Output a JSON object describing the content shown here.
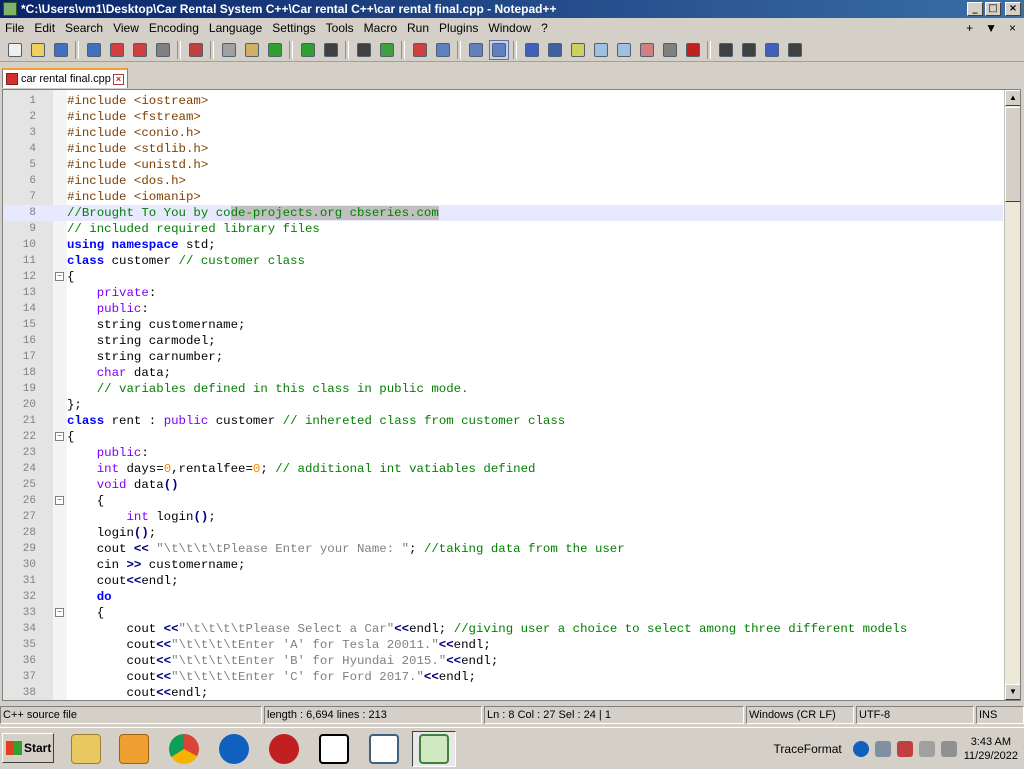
{
  "window": {
    "title": "*C:\\Users\\vm1\\Desktop\\Car Rental System C++\\Car rental C++\\car rental final.cpp - Notepad++",
    "min": "_",
    "max": "□",
    "close": "×"
  },
  "menu": {
    "items": [
      "File",
      "Edit",
      "Search",
      "View",
      "Encoding",
      "Language",
      "Settings",
      "Tools",
      "Macro",
      "Run",
      "Plugins",
      "Window",
      "?"
    ],
    "right": [
      "+",
      "▼",
      "×"
    ]
  },
  "toolbar": {
    "icons": [
      "new-icon",
      "open-icon",
      "save-icon",
      "save-all-icon",
      "close-icon",
      "close-all-icon",
      "print-icon",
      "cut-icon",
      "copy-icon",
      "paste-icon",
      "undo-icon",
      "redo-icon",
      "find-icon",
      "replace-icon",
      "zoom-in-icon",
      "zoom-out-icon",
      "sync-v-icon",
      "sync-h-icon",
      "wrap-icon",
      "all-chars-icon",
      "indent-guide-icon",
      "udl-icon",
      "doc-map-icon",
      "func-list-icon",
      "folder-workspace-icon",
      "monitor-icon",
      "record-macro-icon",
      "stop-macro-icon",
      "play-macro-icon",
      "run-macro-multiple-icon",
      "save-macro-icon"
    ]
  },
  "tab": {
    "label": "car rental final.cpp",
    "close": "×"
  },
  "editor": {
    "lines": [
      {
        "n": "1",
        "html": "<span class='s-pre'>#include &lt;iostream&gt;</span>"
      },
      {
        "n": "2",
        "html": "<span class='s-pre'>#include &lt;fstream&gt;</span>"
      },
      {
        "n": "3",
        "html": "<span class='s-pre'>#include &lt;conio.h&gt;</span>"
      },
      {
        "n": "4",
        "html": "<span class='s-pre'>#include &lt;stdlib.h&gt;</span>"
      },
      {
        "n": "5",
        "html": "<span class='s-pre'>#include &lt;unistd.h&gt;</span>"
      },
      {
        "n": "6",
        "html": "<span class='s-pre'>#include &lt;dos.h&gt;</span>"
      },
      {
        "n": "7",
        "html": "<span class='s-pre'>#include &lt;iomanip&gt;</span>"
      },
      {
        "n": "8",
        "html": "<span class='s-com'>//Brought To You by co<span class='s-sel'>de-projects.org cbseries.com</span></span>",
        "current": true
      },
      {
        "n": "9",
        "html": "<span class='s-com'>// included required library files</span>"
      },
      {
        "n": "10",
        "html": "<span class='s-kw'>using namespace</span> std;"
      },
      {
        "n": "11",
        "html": "<span class='s-kw'>class</span> customer <span class='s-com'>// customer class</span>"
      },
      {
        "n": "12",
        "html": "{",
        "fold": "−"
      },
      {
        "n": "13",
        "html": "    <span class='s-ty'>private</span>:"
      },
      {
        "n": "14",
        "html": "    <span class='s-ty'>public</span>:"
      },
      {
        "n": "15",
        "html": "    string customername;"
      },
      {
        "n": "16",
        "html": "    string carmodel;"
      },
      {
        "n": "17",
        "html": "    string carnumber;"
      },
      {
        "n": "18",
        "html": "    <span class='s-ty'>char</span> data;"
      },
      {
        "n": "19",
        "html": "    <span class='s-com'>// variables defined in this class in public mode.</span>"
      },
      {
        "n": "20",
        "html": "};"
      },
      {
        "n": "21",
        "html": "<span class='s-kw'>class</span> rent : <span class='s-ty'>public</span> customer <span class='s-com'>// inhereted class from customer class</span>"
      },
      {
        "n": "22",
        "html": "{",
        "fold": "−"
      },
      {
        "n": "23",
        "html": "    <span class='s-ty'>public</span>:"
      },
      {
        "n": "24",
        "html": "    <span class='s-ty'>int</span> days=<span class='s-num'>0</span>,rentalfee=<span class='s-num'>0</span>; <span class='s-com'>// additional int vatiables defined</span>"
      },
      {
        "n": "25",
        "html": "    <span class='s-ty'>void</span> data<span class='s-op'>()</span>"
      },
      {
        "n": "26",
        "html": "    {",
        "fold": "−"
      },
      {
        "n": "27",
        "html": "        <span class='s-ty'>int</span> login<span class='s-op'>()</span>;"
      },
      {
        "n": "28",
        "html": "    login<span class='s-op'>()</span>;"
      },
      {
        "n": "29",
        "html": "    cout <span class='s-op'>&lt;&lt;</span> <span class='s-str'>\"\\t\\t\\t\\tPlease Enter your Name: \"</span>; <span class='s-com'>//taking data from the user</span>"
      },
      {
        "n": "30",
        "html": "    cin <span class='s-op'>&gt;&gt;</span> customername;"
      },
      {
        "n": "31",
        "html": "    cout<span class='s-op'>&lt;&lt;</span>endl;"
      },
      {
        "n": "32",
        "html": "    <span class='s-kw'>do</span>"
      },
      {
        "n": "33",
        "html": "    {",
        "fold": "−"
      },
      {
        "n": "34",
        "html": "        cout <span class='s-op'>&lt;&lt;</span><span class='s-str'>\"\\t\\t\\t\\tPlease Select a Car\"</span><span class='s-op'>&lt;&lt;</span>endl; <span class='s-com'>//giving user a choice to select among three different models</span>"
      },
      {
        "n": "35",
        "html": "        cout<span class='s-op'>&lt;&lt;</span><span class='s-str'>\"\\t\\t\\t\\tEnter 'A' for Tesla 20011.\"</span><span class='s-op'>&lt;&lt;</span>endl;"
      },
      {
        "n": "36",
        "html": "        cout<span class='s-op'>&lt;&lt;</span><span class='s-str'>\"\\t\\t\\t\\tEnter 'B' for Hyundai 2015.\"</span><span class='s-op'>&lt;&lt;</span>endl;"
      },
      {
        "n": "37",
        "html": "        cout<span class='s-op'>&lt;&lt;</span><span class='s-str'>\"\\t\\t\\t\\tEnter 'C' for Ford 2017.\"</span><span class='s-op'>&lt;&lt;</span>endl;"
      },
      {
        "n": "38",
        "html": "        cout<span class='s-op'>&lt;&lt;</span>endl;"
      }
    ]
  },
  "status": {
    "file_type": "C++ source file",
    "length": "length : 6,694    lines : 213",
    "position": "Ln : 8    Col : 27    Sel : 24 | 1",
    "eol": "Windows (CR LF)",
    "encoding": "UTF-8",
    "mode": "INS"
  },
  "taskbar": {
    "start": "Start",
    "tracefmt": "TraceFormat",
    "time": "3:43 AM",
    "date": "11/29/2022"
  }
}
